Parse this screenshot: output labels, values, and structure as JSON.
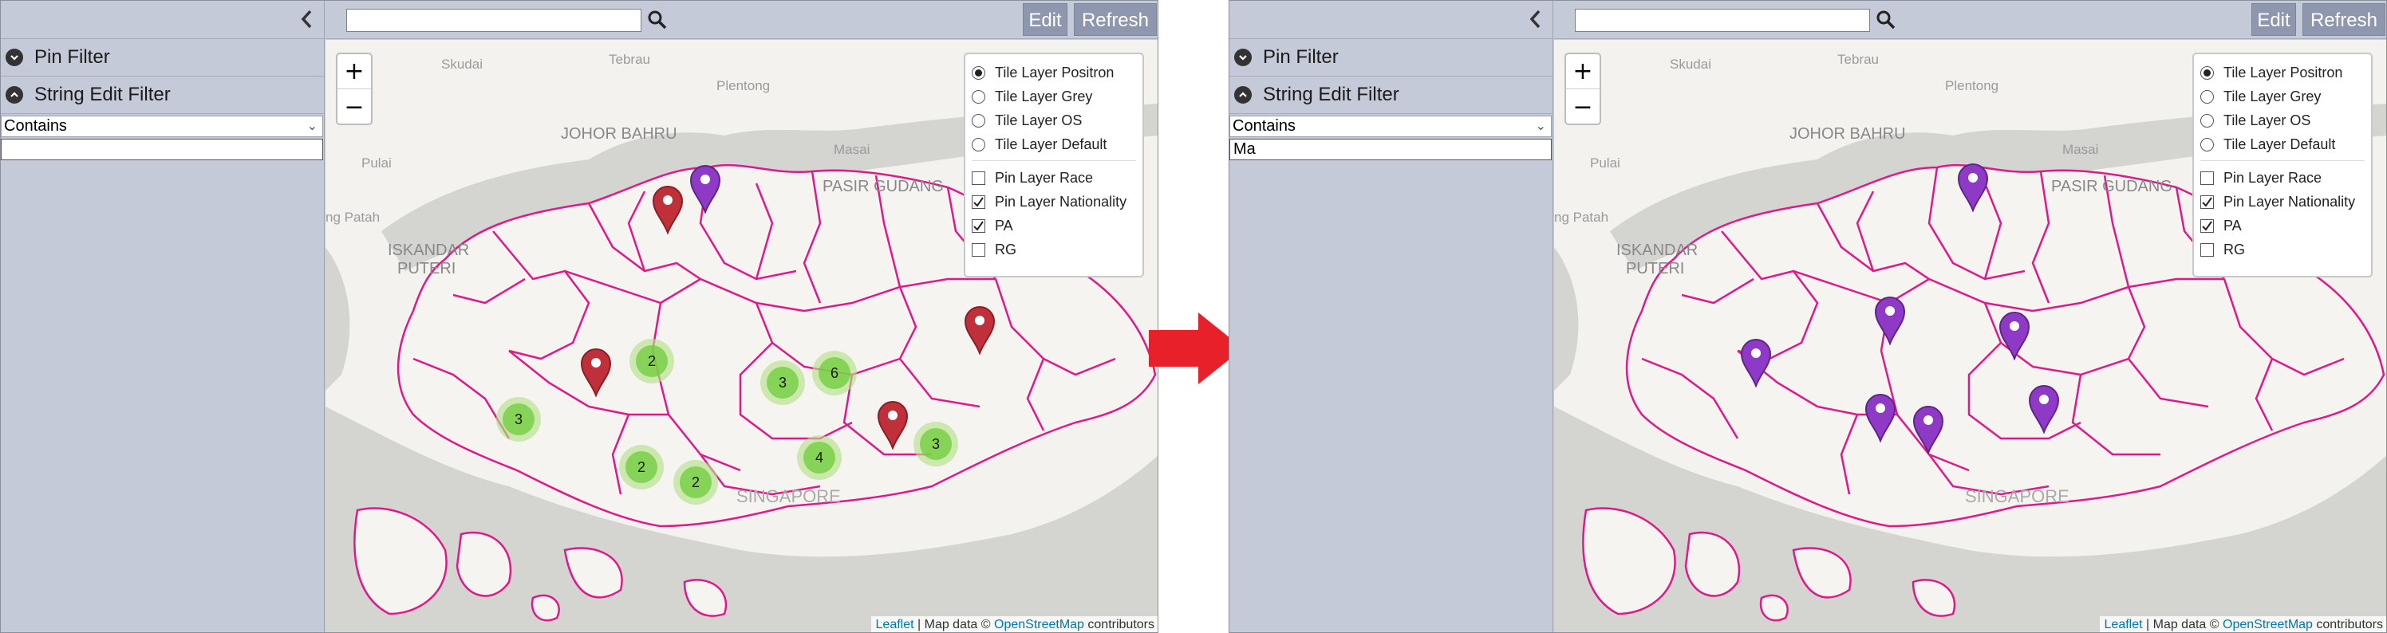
{
  "before": {
    "sidebar": {
      "sections": [
        {
          "label": "Pin Filter",
          "icon": "chevron-down-circle-icon"
        },
        {
          "label": "String Edit Filter",
          "icon": "chevron-up-circle-icon"
        }
      ],
      "filter_mode": "Contains",
      "filter_value": ""
    },
    "toolbar": {
      "search_value": "",
      "edit_label": "Edit",
      "refresh_label": "Refresh"
    },
    "map": {
      "zoom_in_label": "+",
      "zoom_out_label": "−",
      "place_labels": [
        "Skudai",
        "Tebrau",
        "Plentong",
        "JOHOR BAHRU",
        "Masai",
        "PASIR GUDANG",
        "Pulai",
        "ng Patah",
        "ISKANDAR",
        "PUTERI",
        "SINGAPORE"
      ],
      "layers": {
        "base": [
          {
            "label": "Tile Layer Positron",
            "selected": true
          },
          {
            "label": "Tile Layer Grey",
            "selected": false
          },
          {
            "label": "Tile Layer OS",
            "selected": false
          },
          {
            "label": "Tile Layer Default",
            "selected": false
          }
        ],
        "overlays": [
          {
            "label": "Pin Layer Race",
            "checked": false
          },
          {
            "label": "Pin Layer Nationality",
            "checked": true
          },
          {
            "label": "PA",
            "checked": true
          },
          {
            "label": "RG",
            "checked": false
          }
        ]
      },
      "clusters": [
        {
          "count": "2"
        },
        {
          "count": "3"
        },
        {
          "count": "6"
        },
        {
          "count": "3"
        },
        {
          "count": "2"
        },
        {
          "count": "2"
        },
        {
          "count": "4"
        },
        {
          "count": "3"
        }
      ],
      "pins": [
        {
          "color": "#c0303a",
          "name": "red"
        },
        {
          "color": "#8e3ac6",
          "name": "purple"
        },
        {
          "color": "#c0303a",
          "name": "red"
        },
        {
          "color": "#c0303a",
          "name": "red"
        },
        {
          "color": "#c0303a",
          "name": "red"
        }
      ],
      "attribution": {
        "leaflet": "Leaflet",
        "text": " | Map data © ",
        "osm": "OpenStreetMap",
        "suffix": " contributors"
      }
    }
  },
  "after": {
    "sidebar": {
      "sections": [
        {
          "label": "Pin Filter",
          "icon": "chevron-down-circle-icon"
        },
        {
          "label": "String Edit Filter",
          "icon": "chevron-up-circle-icon"
        }
      ],
      "filter_mode": "Contains",
      "filter_value": "Ma"
    },
    "toolbar": {
      "search_value": "",
      "edit_label": "Edit",
      "refresh_label": "Refresh"
    },
    "map": {
      "zoom_in_label": "+",
      "zoom_out_label": "−",
      "place_labels": [
        "Skudai",
        "Tebrau",
        "Plentong",
        "JOHOR BAHRU",
        "Masai",
        "PASIR GUDANG",
        "Pulai",
        "ng Patah",
        "ISKANDAR",
        "PUTERI",
        "SINGAPORE"
      ],
      "layers": {
        "base": [
          {
            "label": "Tile Layer Positron",
            "selected": true
          },
          {
            "label": "Tile Layer Grey",
            "selected": false
          },
          {
            "label": "Tile Layer OS",
            "selected": false
          },
          {
            "label": "Tile Layer Default",
            "selected": false
          }
        ],
        "overlays": [
          {
            "label": "Pin Layer Race",
            "checked": false
          },
          {
            "label": "Pin Layer Nationality",
            "checked": true
          },
          {
            "label": "PA",
            "checked": true
          },
          {
            "label": "RG",
            "checked": false
          }
        ]
      },
      "pins": [
        {
          "color": "#8e3ac6",
          "name": "purple"
        },
        {
          "color": "#8e3ac6",
          "name": "purple"
        },
        {
          "color": "#8e3ac6",
          "name": "purple"
        },
        {
          "color": "#8e3ac6",
          "name": "purple"
        },
        {
          "color": "#8e3ac6",
          "name": "purple"
        },
        {
          "color": "#8e3ac6",
          "name": "purple"
        },
        {
          "color": "#8e3ac6",
          "name": "purple"
        }
      ],
      "attribution": {
        "leaflet": "Leaflet",
        "text": " | Map data © ",
        "osm": "OpenStreetMap",
        "suffix": " contributors"
      }
    }
  },
  "transition_arrow": {
    "color": "#e8202a",
    "icon": "right-arrow-icon"
  }
}
